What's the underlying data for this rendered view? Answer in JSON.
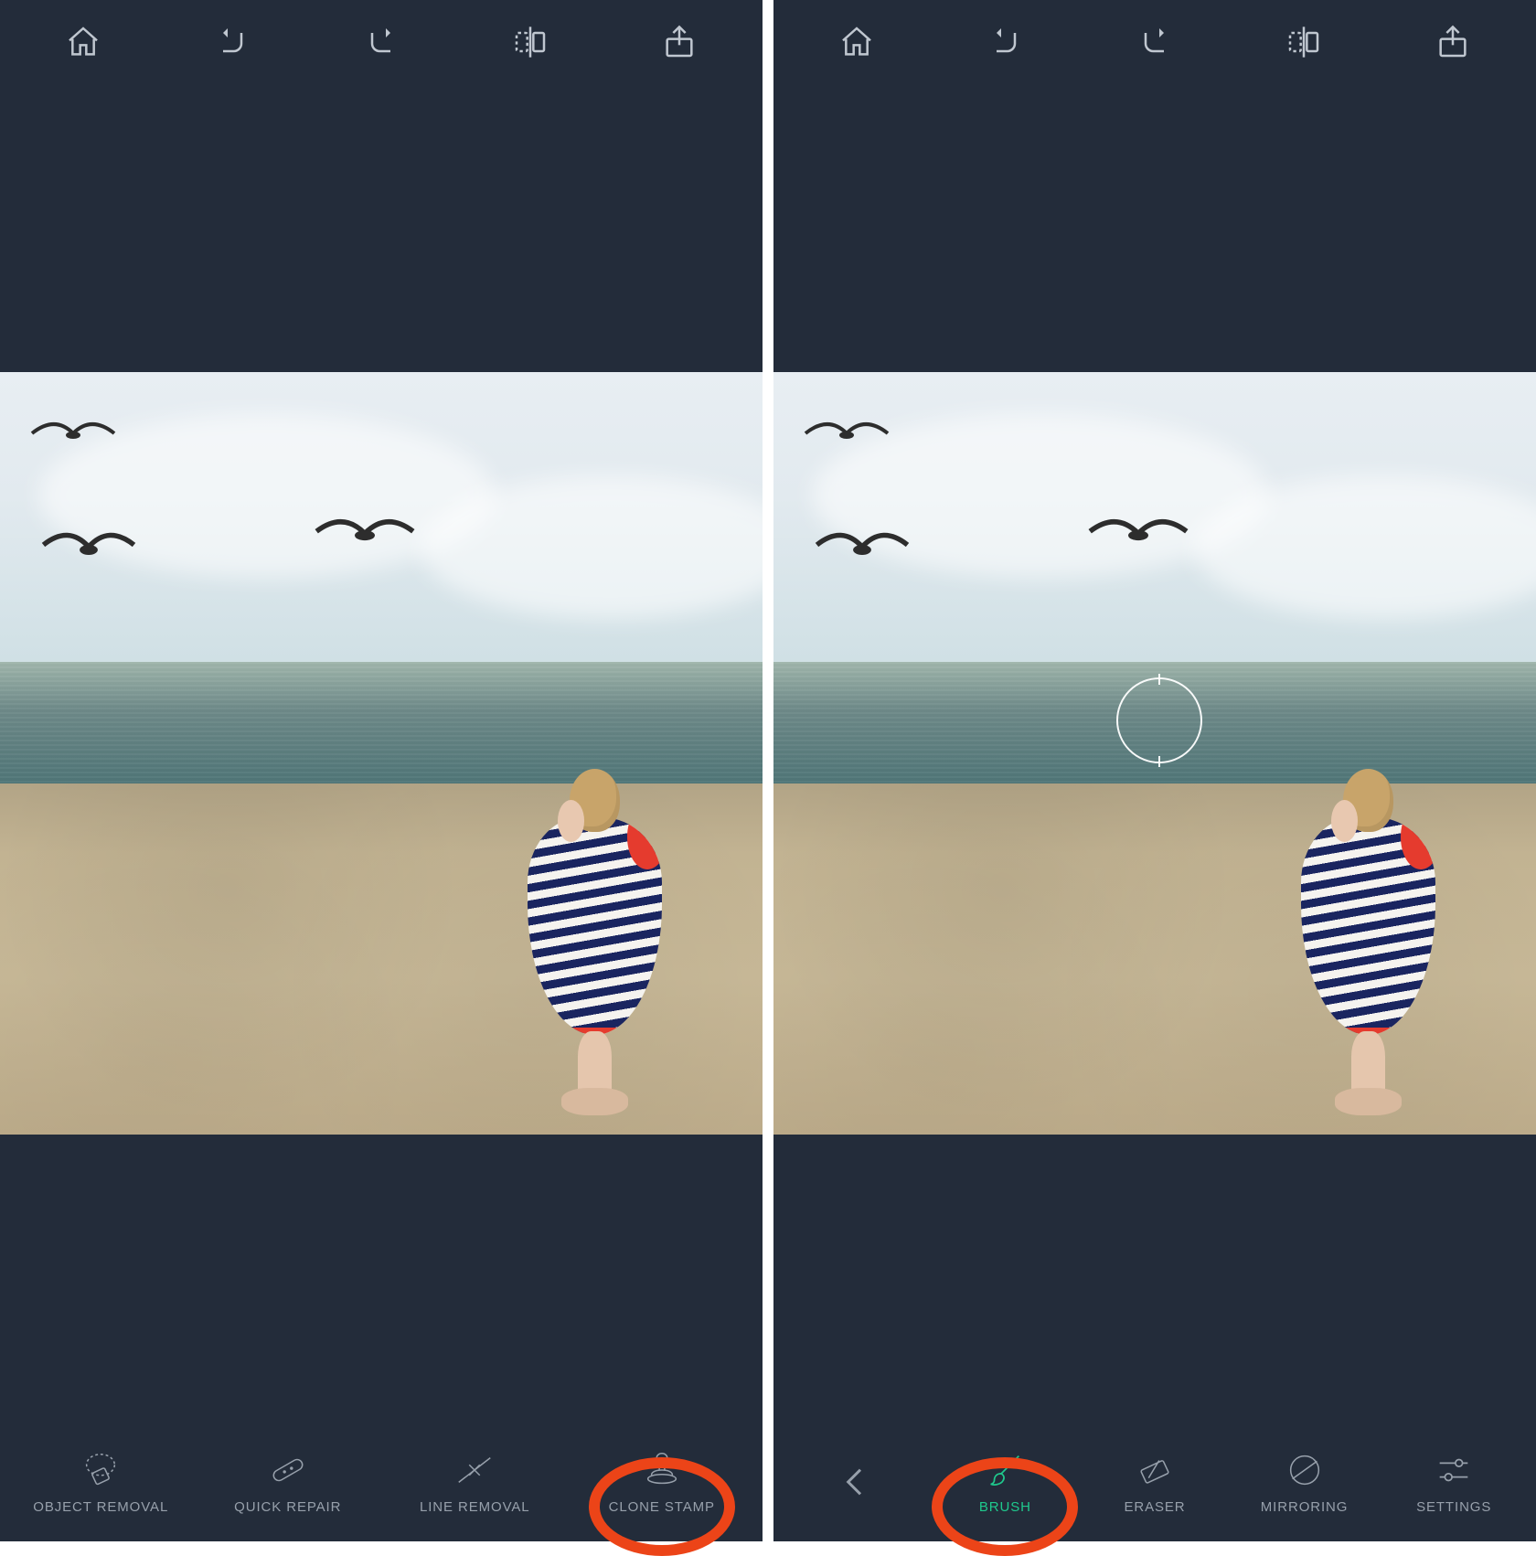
{
  "colors": {
    "accent": "#1fc98d",
    "highlight": "#ec4418",
    "chrome_bg": "#232c3a",
    "icon": "#97a0ab"
  },
  "left_screen": {
    "topbar": [
      "home-icon",
      "undo-icon",
      "redo-icon",
      "compare-icon",
      "share-icon"
    ],
    "tools": [
      {
        "id": "object-removal",
        "label": "OBJECT REMOVAL",
        "active": false,
        "highlighted": false
      },
      {
        "id": "quick-repair",
        "label": "QUICK REPAIR",
        "active": false,
        "highlighted": false
      },
      {
        "id": "line-removal",
        "label": "LINE REMOVAL",
        "active": false,
        "highlighted": false
      },
      {
        "id": "clone-stamp",
        "label": "CLONE STAMP",
        "active": false,
        "highlighted": true
      }
    ]
  },
  "right_screen": {
    "topbar": [
      "home-icon",
      "undo-icon",
      "redo-icon",
      "compare-icon",
      "share-icon"
    ],
    "clone_target_visible": true,
    "tools": [
      {
        "id": "back",
        "label": "",
        "active": false,
        "highlighted": false,
        "is_back": true
      },
      {
        "id": "brush",
        "label": "BRUSH",
        "active": true,
        "highlighted": true
      },
      {
        "id": "eraser",
        "label": "ERASER",
        "active": false,
        "highlighted": false
      },
      {
        "id": "mirroring",
        "label": "MIRRORING",
        "active": false,
        "highlighted": false
      },
      {
        "id": "settings",
        "label": "SETTINGS",
        "active": false,
        "highlighted": false
      }
    ]
  }
}
